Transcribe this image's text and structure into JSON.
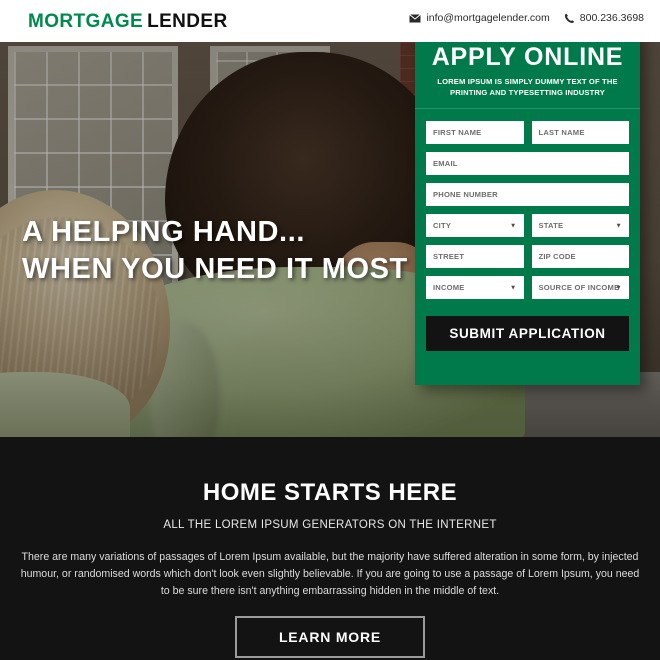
{
  "header": {
    "logo_primary": "MORTGAGE",
    "logo_secondary": "LENDER",
    "email_icon": "envelope-icon",
    "email": "info@mortgagelender.com",
    "phone_icon": "phone-icon",
    "phone": "800.236.3698"
  },
  "hero": {
    "headline_line1": "A HELPING HAND...",
    "headline_line2": "WHEN YOU NEED IT MOST",
    "image_description": "Couple seen from behind looking at a house with white windows and brick facade"
  },
  "form": {
    "title": "APPLY ONLINE",
    "subtitle": "LOREM IPSUM IS SIMPLY DUMMY TEXT OF THE PRINTING AND TYPESETTING INDUSTRY",
    "fields": [
      {
        "name": "first-name",
        "placeholder": "FIRST NAME",
        "value": "",
        "type": "text"
      },
      {
        "name": "last-name",
        "placeholder": "LAST NAME",
        "value": "",
        "type": "text"
      },
      {
        "name": "email",
        "placeholder": "EMAIL",
        "value": "",
        "type": "text"
      },
      {
        "name": "phone-number",
        "placeholder": "PHONE NUMBER",
        "value": "",
        "type": "text"
      },
      {
        "name": "city",
        "placeholder": "CITY",
        "value": "",
        "type": "select"
      },
      {
        "name": "state",
        "placeholder": "STATE",
        "value": "",
        "type": "select"
      },
      {
        "name": "street",
        "placeholder": "STREET",
        "value": "",
        "type": "text"
      },
      {
        "name": "zip-code",
        "placeholder": "ZIP CODE",
        "value": "",
        "type": "text"
      },
      {
        "name": "income",
        "placeholder": "INCOME",
        "value": "",
        "type": "select"
      },
      {
        "name": "source-of-income",
        "placeholder": "SOURCE OF INCOME",
        "value": "",
        "type": "select"
      }
    ],
    "submit_label": "SUBMIT APPLICATION",
    "caret_glyph": "▼"
  },
  "bottom": {
    "title": "HOME STARTS HERE",
    "subtitle": "ALL THE LOREM IPSUM GENERATORS ON THE INTERNET",
    "body": "There are many variations of passages of Lorem Ipsum available, but the majority have suffered alteration in some form, by injected humour, or randomised words which don't look even slightly believable. If you are going to use a passage of Lorem Ipsum, you need to be sure there isn't anything embarrassing hidden in the middle of text.",
    "cta_label": "LEARN MORE"
  },
  "colors": {
    "brand_green": "#007a4a",
    "logo_green": "#00894f",
    "dark": "#131313",
    "white": "#ffffff",
    "cta_border": "#9b9b9b"
  }
}
